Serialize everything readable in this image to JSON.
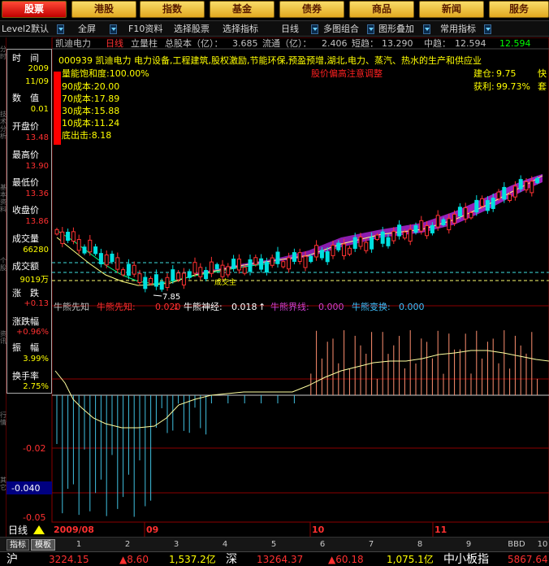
{
  "topnav": [
    {
      "label": "股票",
      "active": true
    },
    {
      "label": "港股"
    },
    {
      "label": "指数"
    },
    {
      "label": "基金"
    },
    {
      "label": "债券"
    },
    {
      "label": "商品"
    },
    {
      "label": "新闻"
    },
    {
      "label": "服务"
    }
  ],
  "toolbar": {
    "level2": "Level2默认",
    "fullscreen": "全屏",
    "f10": "F10资料",
    "select_stock": "选择股票",
    "select_indicator": "选择指标",
    "period": "日线",
    "multi_chart": "多图组合",
    "overlay": "图形叠加",
    "common_indicator": "常用指标"
  },
  "chart_header": {
    "name": "凯迪电力",
    "period": "日线",
    "mode": "立量柱",
    "total_shares_label": "总股本（亿）：",
    "total_shares": "3.685",
    "float_label": "流通（亿）：",
    "float": "2.406",
    "short_label": "短趋：",
    "short": "13.290",
    "mid_label": "中趋：",
    "mid": "12.594",
    "extra": "12.594"
  },
  "info_panel": {
    "time_label": "时　间",
    "time_year": "2009",
    "time_date": "11/09",
    "value_label": "数　值",
    "value": "0.01",
    "open_label": "开盘价",
    "open": "13.48",
    "high_label": "最高价",
    "high": "13.90",
    "low_label": "最低价",
    "low": "13.36",
    "close_label": "收盘价",
    "close": "13.86",
    "volume_label": "成交量",
    "volume": "66280",
    "amount_label": "成交额",
    "amount": "9019万",
    "change_label": "涨　跌",
    "change": "+0.13",
    "pct_label": "涨跌幅",
    "pct": "+0.96%",
    "amp_label": "振　幅",
    "amp": "3.99%",
    "turnover_label": "换手率",
    "turnover": "2.75%"
  },
  "stock_info": {
    "line1": "000939 凯迪电力 电力设备,工程建筑,股权激励,节能环保,预盈预增,湖北,电力、蒸汽、热水的生产和供应业",
    "saturation": "量能饱和度:100.00%",
    "c90": "90成本:20.00",
    "c70": "70成本:17.89",
    "c30": "30成本:15.88",
    "c10": "10成本:11.24",
    "bottom": "底出击:8.18",
    "red_note": "股价偏高注意调整",
    "build_label": "建仓:",
    "build": "9.75",
    "profit_label": "获利:",
    "profit": "99.73%",
    "right1": "快",
    "right2": "套"
  },
  "price_annotations": {
    "low_mark": "7.85",
    "label_mid": "成交主"
  },
  "indicator": {
    "title": "牛熊先知",
    "items": [
      {
        "label": "牛熊先知:",
        "value": "0.020",
        "arrow": "↓",
        "color": "#ff3030"
      },
      {
        "label": "牛熊神经:",
        "value": "0.018",
        "arrow": "↑",
        "color": "#ffffff"
      },
      {
        "label": "牛熊界线:",
        "value": "0.000",
        "color": "#d040d0"
      },
      {
        "label": "牛熊变换:",
        "value": "0.000",
        "color": "#40c0ff"
      }
    ],
    "axis_labels": [
      "-0.02",
      "-0.05"
    ],
    "current_value": "-0.040"
  },
  "time_axis": {
    "labels": [
      {
        "text": "2009/08"
      },
      {
        "text": "09"
      },
      {
        "text": "10"
      },
      {
        "text": "11"
      }
    ]
  },
  "bottom_tabs": {
    "period": "日线",
    "indicator_tab": "指标",
    "template_tab": "模板",
    "nums": [
      "1",
      "2",
      "3",
      "4",
      "5",
      "6",
      "7",
      "8",
      "9",
      "BBD",
      "10"
    ]
  },
  "statusbar": {
    "sh_label": "沪",
    "sh_index": "3224.15",
    "sh_change": "▲8.60",
    "sh_amount": "1,537.2亿",
    "sz_label": "深",
    "sz_index": "13264.37",
    "sz_change": "▲60.18",
    "sz_amount": "1,075.1亿",
    "sme_label": "中小板指",
    "sme_index": "5867.64"
  },
  "colors": {
    "up": "#ff3232",
    "down": "#00ffff",
    "highlight": "#ffff00",
    "grid": "#8b0000",
    "cyan_line": "#40e0e0"
  },
  "chart_data": {
    "type": "candlestick",
    "x": [
      "2009/08",
      "09",
      "10",
      "11"
    ],
    "annotations": [
      "7.85"
    ],
    "indicator_ticks": [
      "-0.02",
      "-0.05"
    ],
    "indicator_current": "-0.040"
  }
}
